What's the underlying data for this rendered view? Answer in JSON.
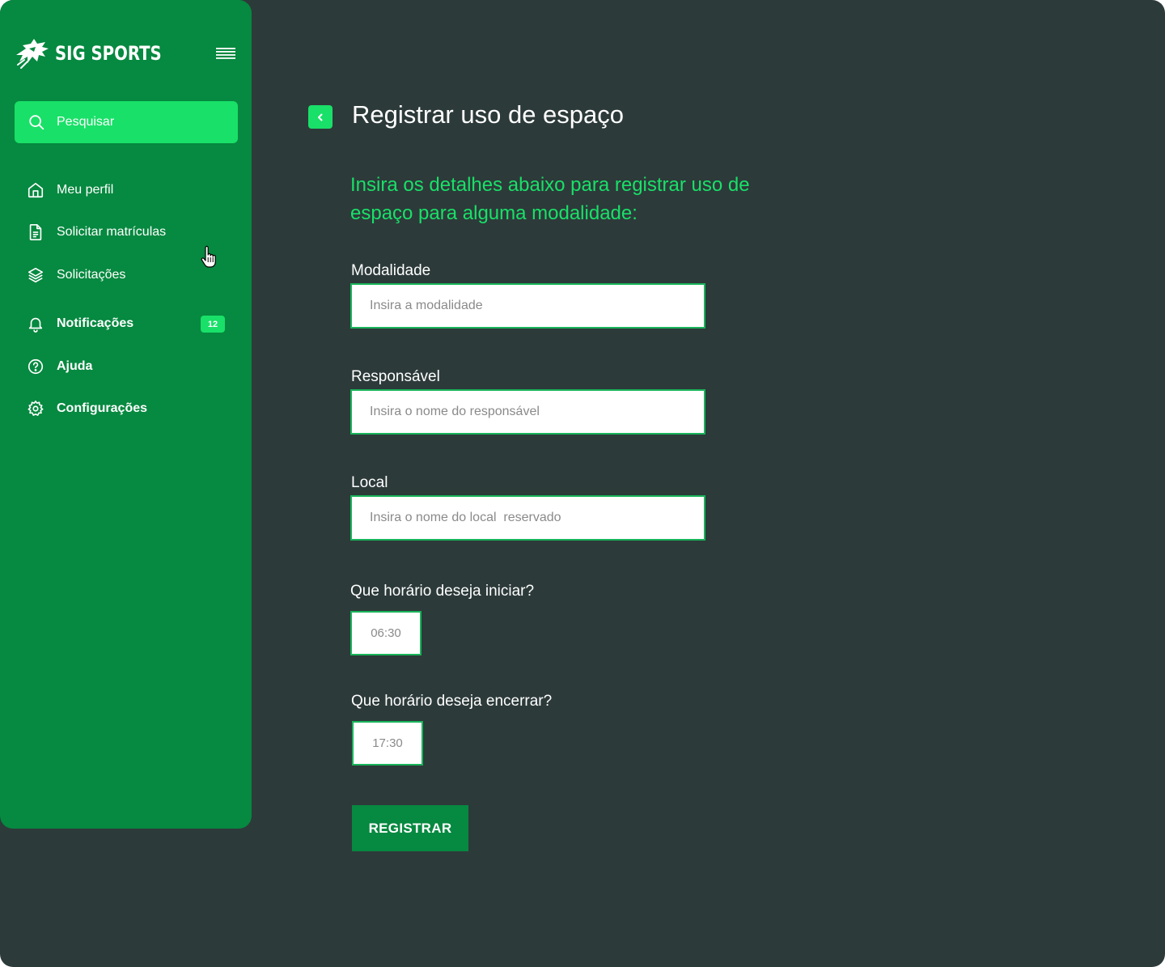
{
  "app": {
    "brand_name": "SIG SPORTS",
    "colors": {
      "sidebar": "#068940",
      "accent": "#19e068",
      "background": "#2d3a3a"
    }
  },
  "sidebar": {
    "search_label": "Pesquisar",
    "items": [
      {
        "label": "Meu perfil",
        "icon": "home-icon"
      },
      {
        "label": "Solicitar matrículas",
        "icon": "document-icon"
      },
      {
        "label": "Solicitações",
        "icon": "layers-icon"
      },
      {
        "label": "Notificações",
        "icon": "bell-icon",
        "badge": "12"
      },
      {
        "label": "Ajuda",
        "icon": "help-circle-icon"
      },
      {
        "label": "Configurações",
        "icon": "gear-icon"
      }
    ]
  },
  "main": {
    "title": "Registrar uso de espaço",
    "subtitle": "Insira os detalhes abaixo para registrar uso de espaço para alguma modalidade:",
    "form": {
      "modalidade": {
        "label": "Modalidade",
        "placeholder": "Insira a modalidade"
      },
      "responsavel": {
        "label": "Responsável",
        "placeholder": "Insira o nome do responsável"
      },
      "local": {
        "label": "Local",
        "placeholder": "Insira o nome do local  reservado"
      },
      "inicio": {
        "label": "Que horário deseja iniciar?",
        "placeholder": "06:30"
      },
      "fim": {
        "label": "Que horário deseja encerrar?",
        "placeholder": "17:30"
      },
      "submit_label": "REGISTRAR"
    }
  }
}
